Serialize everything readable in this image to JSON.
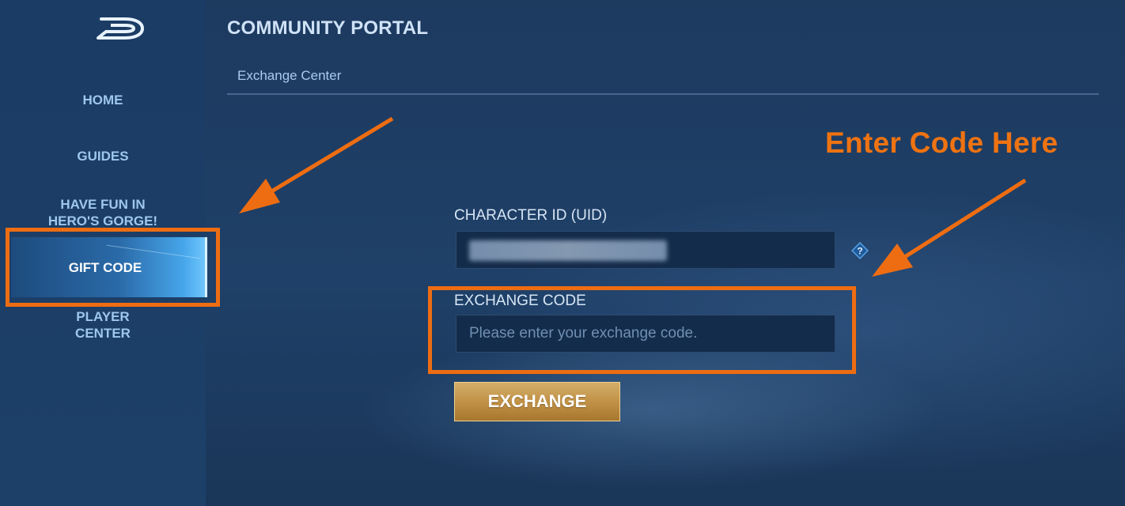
{
  "header": {
    "title": "COMMUNITY PORTAL",
    "breadcrumb": "Exchange Center"
  },
  "sidebar": {
    "items": [
      {
        "label": "HOME"
      },
      {
        "label": "GUIDES"
      },
      {
        "label": "HAVE FUN IN HERO'S GORGE!"
      },
      {
        "label": "GIFT CODE",
        "active": true
      },
      {
        "label": "PLAYER CENTER"
      }
    ]
  },
  "form": {
    "uid_label": "CHARACTER ID (UID)",
    "code_label": "EXCHANGE CODE",
    "code_placeholder": "Please enter your exchange code.",
    "exchange_button": "EXCHANGE"
  },
  "annotation": {
    "text": "Enter Code Here",
    "color": "#ee6d12"
  },
  "icons": [
    "logo-icon",
    "help-icon",
    "arrow-icon"
  ],
  "colors": {
    "accent_orange": "#ee6d12",
    "button_gold": "#c19247",
    "nav_text": "#9ec6ee"
  }
}
